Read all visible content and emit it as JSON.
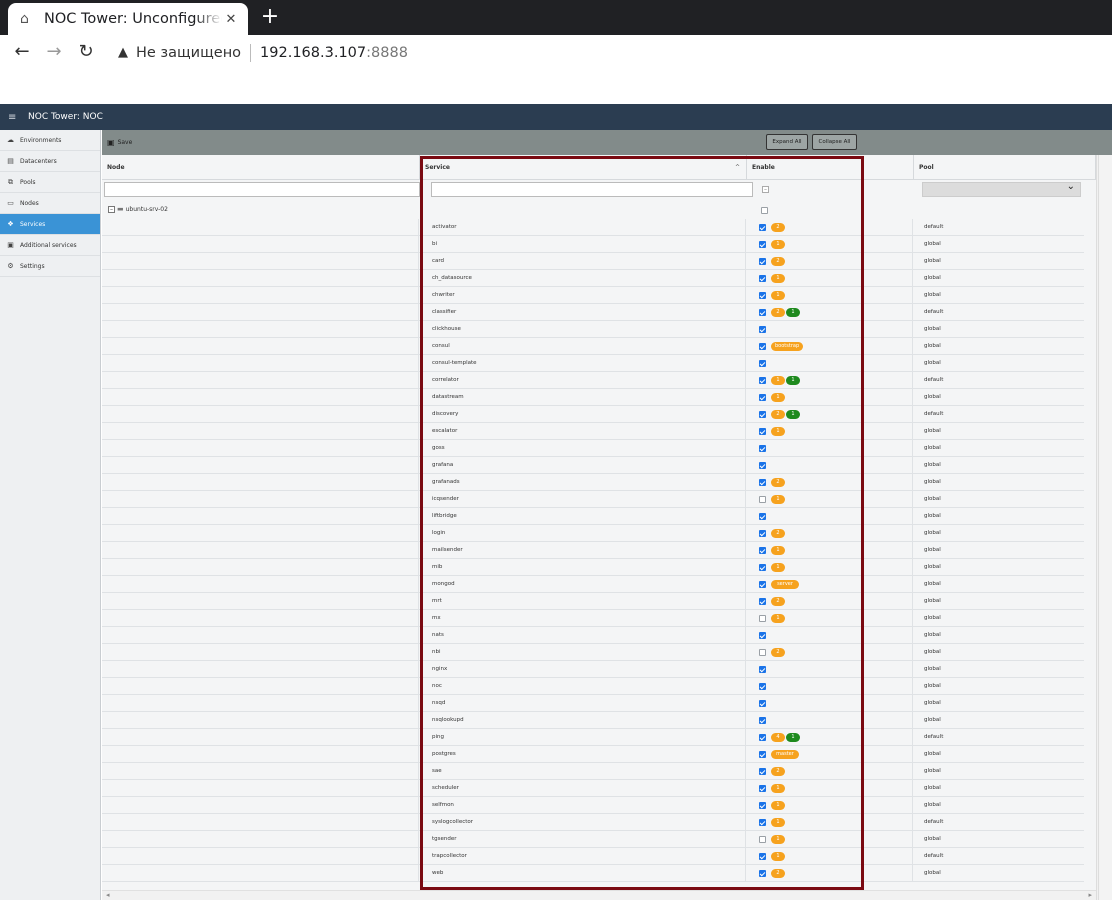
{
  "browser": {
    "tab_title": "NOC Tower: Unconfigured",
    "tab_close": "✕",
    "new_tab": "+",
    "security_label": "Не защищено",
    "url_host": "192.168.3.107",
    "url_port": ":8888"
  },
  "header": {
    "title": "NOC Tower: NOC"
  },
  "sidebar": {
    "items": [
      {
        "label": "Environments",
        "icon": "cloud-icon"
      },
      {
        "label": "Datacenters",
        "icon": "server-icon"
      },
      {
        "label": "Pools",
        "icon": "pools-icon"
      },
      {
        "label": "Nodes",
        "icon": "node-icon"
      },
      {
        "label": "Services",
        "icon": "cubes-icon",
        "active": true
      },
      {
        "label": "Additional services",
        "icon": "box-icon"
      },
      {
        "label": "Settings",
        "icon": "gear-icon"
      }
    ]
  },
  "toolbar": {
    "save_label": "Save",
    "expand_label": "Expand All",
    "collapse_label": "Collapse All"
  },
  "columns": {
    "node": "Node",
    "service": "Service",
    "enable": "Enable",
    "pool": "Pool"
  },
  "tree": {
    "node_label": "ubuntu-srv-02"
  },
  "services": [
    {
      "name": "activator",
      "enabled": true,
      "badges": [
        {
          "t": "2",
          "c": "orange"
        }
      ],
      "pool": "default"
    },
    {
      "name": "bi",
      "enabled": true,
      "badges": [
        {
          "t": "1",
          "c": "orange"
        }
      ],
      "pool": "global"
    },
    {
      "name": "card",
      "enabled": true,
      "badges": [
        {
          "t": "2",
          "c": "orange"
        }
      ],
      "pool": "global"
    },
    {
      "name": "ch_datasource",
      "enabled": true,
      "badges": [
        {
          "t": "1",
          "c": "orange"
        }
      ],
      "pool": "global"
    },
    {
      "name": "chwriter",
      "enabled": true,
      "badges": [
        {
          "t": "1",
          "c": "orange"
        }
      ],
      "pool": "global"
    },
    {
      "name": "classifier",
      "enabled": true,
      "badges": [
        {
          "t": "2",
          "c": "orange"
        },
        {
          "t": "1",
          "c": "green"
        }
      ],
      "pool": "default"
    },
    {
      "name": "clickhouse",
      "enabled": true,
      "badges": [],
      "pool": "global"
    },
    {
      "name": "consul",
      "enabled": true,
      "badges": [
        {
          "t": "bootstrap",
          "c": "orange",
          "wide": true
        }
      ],
      "pool": "global"
    },
    {
      "name": "consul-template",
      "enabled": true,
      "badges": [],
      "pool": "global"
    },
    {
      "name": "correlator",
      "enabled": true,
      "badges": [
        {
          "t": "1",
          "c": "orange"
        },
        {
          "t": "1",
          "c": "green"
        }
      ],
      "pool": "default"
    },
    {
      "name": "datastream",
      "enabled": true,
      "badges": [
        {
          "t": "1",
          "c": "orange"
        }
      ],
      "pool": "global"
    },
    {
      "name": "discovery",
      "enabled": true,
      "badges": [
        {
          "t": "2",
          "c": "orange"
        },
        {
          "t": "1",
          "c": "green"
        }
      ],
      "pool": "default"
    },
    {
      "name": "escalator",
      "enabled": true,
      "badges": [
        {
          "t": "1",
          "c": "orange"
        }
      ],
      "pool": "global"
    },
    {
      "name": "goss",
      "enabled": true,
      "badges": [],
      "pool": "global"
    },
    {
      "name": "grafana",
      "enabled": true,
      "badges": [],
      "pool": "global"
    },
    {
      "name": "grafanads",
      "enabled": true,
      "badges": [
        {
          "t": "2",
          "c": "orange"
        }
      ],
      "pool": "global"
    },
    {
      "name": "icqsender",
      "enabled": false,
      "badges": [
        {
          "t": "1",
          "c": "orange"
        }
      ],
      "pool": "global"
    },
    {
      "name": "liftbridge",
      "enabled": true,
      "badges": [],
      "pool": "global"
    },
    {
      "name": "login",
      "enabled": true,
      "badges": [
        {
          "t": "2",
          "c": "orange"
        }
      ],
      "pool": "global"
    },
    {
      "name": "mailsender",
      "enabled": true,
      "badges": [
        {
          "t": "1",
          "c": "orange"
        }
      ],
      "pool": "global"
    },
    {
      "name": "mib",
      "enabled": true,
      "badges": [
        {
          "t": "1",
          "c": "orange"
        }
      ],
      "pool": "global"
    },
    {
      "name": "mongod",
      "enabled": true,
      "badges": [
        {
          "t": "server",
          "c": "orange",
          "wide": true
        }
      ],
      "pool": "global"
    },
    {
      "name": "mrt",
      "enabled": true,
      "badges": [
        {
          "t": "2",
          "c": "orange"
        }
      ],
      "pool": "global"
    },
    {
      "name": "mx",
      "enabled": false,
      "badges": [
        {
          "t": "1",
          "c": "orange"
        }
      ],
      "pool": "global"
    },
    {
      "name": "nats",
      "enabled": true,
      "badges": [],
      "pool": "global"
    },
    {
      "name": "nbi",
      "enabled": false,
      "badges": [
        {
          "t": "2",
          "c": "orange"
        }
      ],
      "pool": "global"
    },
    {
      "name": "nginx",
      "enabled": true,
      "badges": [],
      "pool": "global"
    },
    {
      "name": "noc",
      "enabled": true,
      "badges": [],
      "pool": "global"
    },
    {
      "name": "nsqd",
      "enabled": true,
      "badges": [],
      "pool": "global"
    },
    {
      "name": "nsqlookupd",
      "enabled": true,
      "badges": [],
      "pool": "global"
    },
    {
      "name": "ping",
      "enabled": true,
      "badges": [
        {
          "t": "4",
          "c": "orange"
        },
        {
          "t": "1",
          "c": "green"
        }
      ],
      "pool": "default"
    },
    {
      "name": "postgres",
      "enabled": true,
      "badges": [
        {
          "t": "master",
          "c": "orange",
          "wide": true
        }
      ],
      "pool": "global"
    },
    {
      "name": "sae",
      "enabled": true,
      "badges": [
        {
          "t": "2",
          "c": "orange"
        }
      ],
      "pool": "global"
    },
    {
      "name": "scheduler",
      "enabled": true,
      "badges": [
        {
          "t": "1",
          "c": "orange"
        }
      ],
      "pool": "global"
    },
    {
      "name": "selfmon",
      "enabled": true,
      "badges": [
        {
          "t": "1",
          "c": "orange"
        }
      ],
      "pool": "global"
    },
    {
      "name": "syslogcollector",
      "enabled": true,
      "badges": [
        {
          "t": "1",
          "c": "orange"
        }
      ],
      "pool": "default"
    },
    {
      "name": "tgsender",
      "enabled": false,
      "badges": [
        {
          "t": "1",
          "c": "orange"
        }
      ],
      "pool": "global"
    },
    {
      "name": "trapcollector",
      "enabled": true,
      "badges": [
        {
          "t": "1",
          "c": "orange"
        }
      ],
      "pool": "default"
    },
    {
      "name": "web",
      "enabled": true,
      "badges": [
        {
          "t": "2",
          "c": "orange"
        }
      ],
      "pool": "global"
    }
  ]
}
